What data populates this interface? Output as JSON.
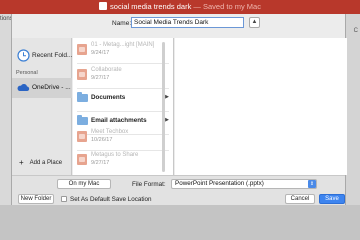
{
  "window": {
    "title": "social media trends dark",
    "title_status": "— Saved to my Mac",
    "left_ribbon_text": "tions",
    "right_ribbon_text": "C"
  },
  "save_dialog": {
    "name_label": "Name:",
    "name_value": "Social Media Trends Dark",
    "collapse_glyph": "▲",
    "sidebar": {
      "recent_label": "Recent Fold...",
      "section_personal": "Personal",
      "onedrive_label": "OneDrive - ...",
      "add_place_label": "Add a Place",
      "add_place_glyph": "+"
    },
    "files": [
      {
        "type": "file",
        "name": "01 - Metag...ight [MAIN]",
        "date": "9/24/17"
      },
      {
        "type": "file",
        "name": "Collaborate",
        "date": "9/27/17"
      },
      {
        "type": "folder",
        "name": "Documents"
      },
      {
        "type": "folder",
        "name": "Email attachments"
      },
      {
        "type": "file",
        "name": "Meet Techbox",
        "date": "10/26/17"
      },
      {
        "type": "file",
        "name": "Metagus to Share",
        "date": "9/27/17"
      }
    ],
    "folder_arrow": "▶",
    "location_button": "On my Mac",
    "file_format_label": "File Format:",
    "file_format_value": "PowerPoint Presentation (.pptx)",
    "format_stepper_glyph": "⇕",
    "new_folder_button": "New Folder",
    "default_location_label": "Set As Default Save Location",
    "cancel_button": "Cancel",
    "save_button": "Save"
  },
  "colors": {
    "titlebar": "#b8382b",
    "accent": "#3d84ef"
  }
}
